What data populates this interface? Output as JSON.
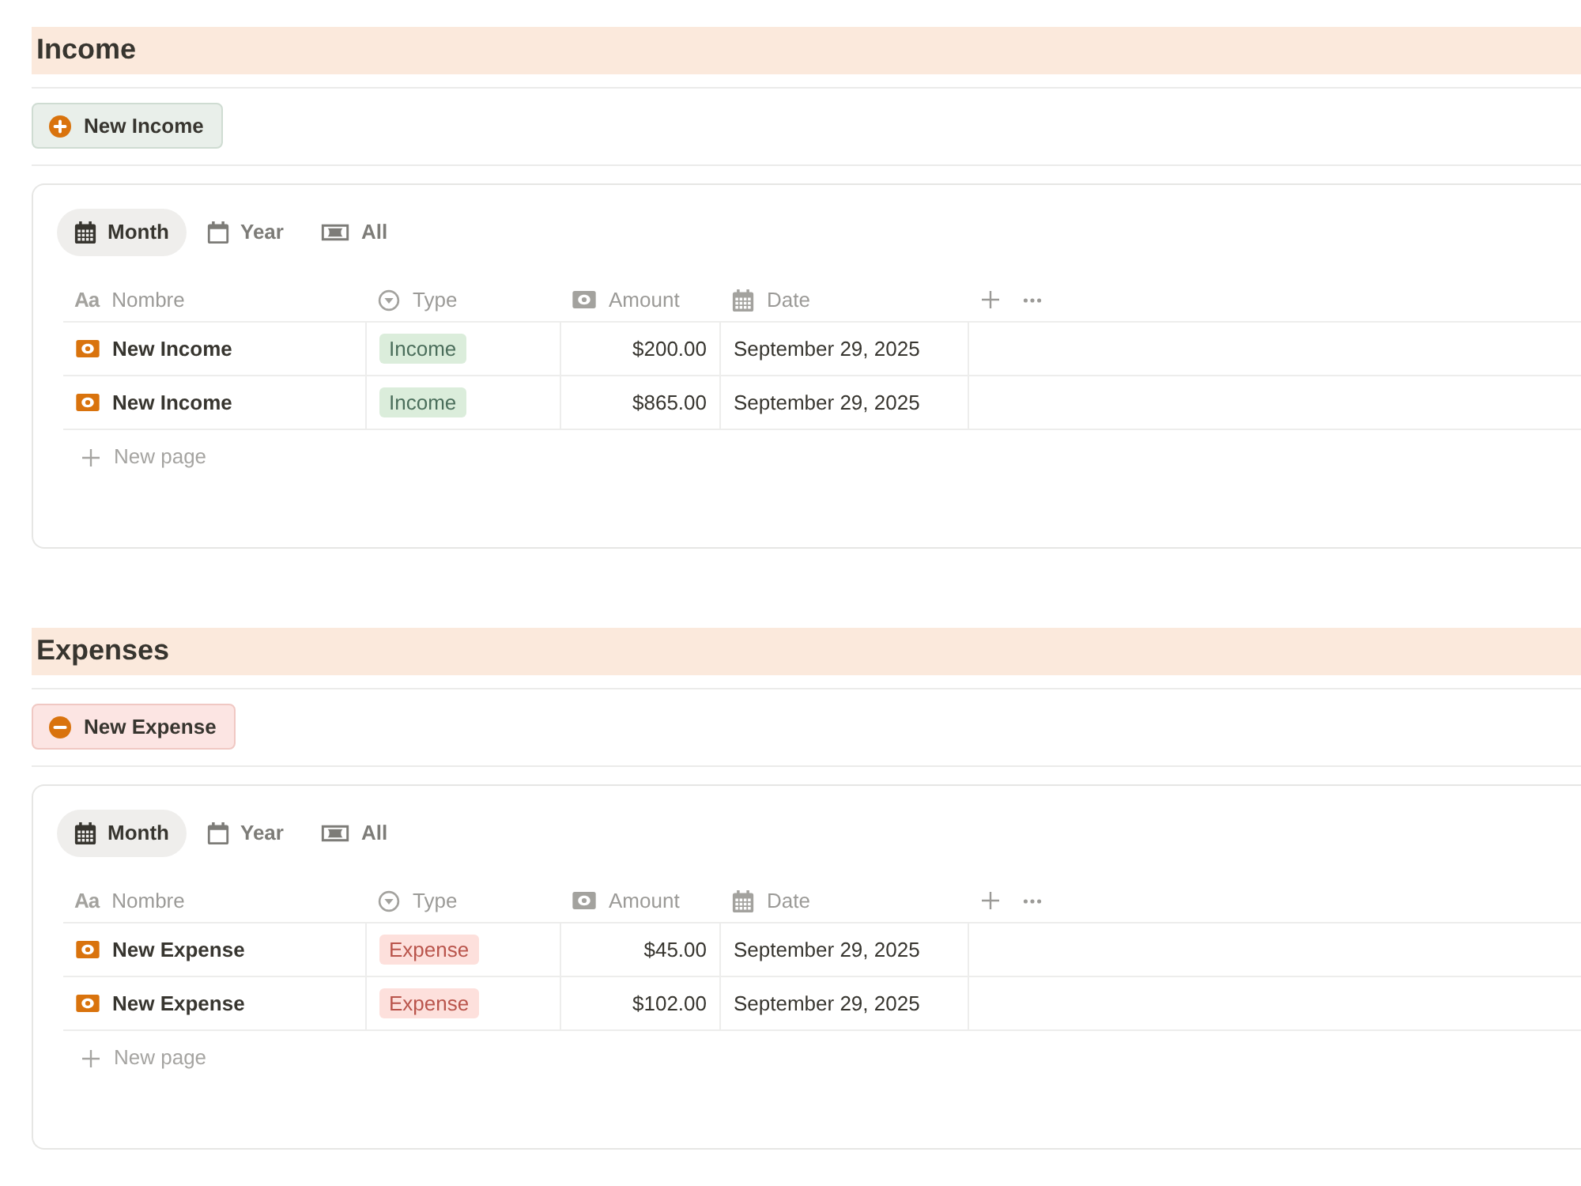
{
  "sections": [
    {
      "kind": "income",
      "title": "Income",
      "button": "New Income",
      "tabs": [
        {
          "label": "Month",
          "selected": true
        },
        {
          "label": "Year",
          "selected": false
        },
        {
          "label": "All",
          "selected": false
        }
      ],
      "columns": [
        {
          "label": "Nombre",
          "glyph": "Aa"
        },
        {
          "label": "Type"
        },
        {
          "label": "Amount"
        },
        {
          "label": "Date"
        }
      ],
      "rows": [
        {
          "name": "New Income",
          "type": "Income",
          "amount": "$200.00",
          "date": "September 29, 2025"
        },
        {
          "name": "New Income",
          "type": "Income",
          "amount": "$865.00",
          "date": "September 29, 2025"
        }
      ],
      "new_row": "New page"
    },
    {
      "kind": "expense",
      "title": "Expenses",
      "button": "New Expense",
      "tabs": [
        {
          "label": "Month",
          "selected": true
        },
        {
          "label": "Year",
          "selected": false
        },
        {
          "label": "All",
          "selected": false
        }
      ],
      "columns": [
        {
          "label": "Nombre",
          "glyph": "Aa"
        },
        {
          "label": "Type"
        },
        {
          "label": "Amount"
        },
        {
          "label": "Date"
        }
      ],
      "rows": [
        {
          "name": "New Expense",
          "type": "Expense",
          "amount": "$45.00",
          "date": "September 29, 2025"
        },
        {
          "name": "New Expense",
          "type": "Expense",
          "amount": "$102.00",
          "date": "September 29, 2025"
        }
      ],
      "new_row": "New page"
    }
  ]
}
